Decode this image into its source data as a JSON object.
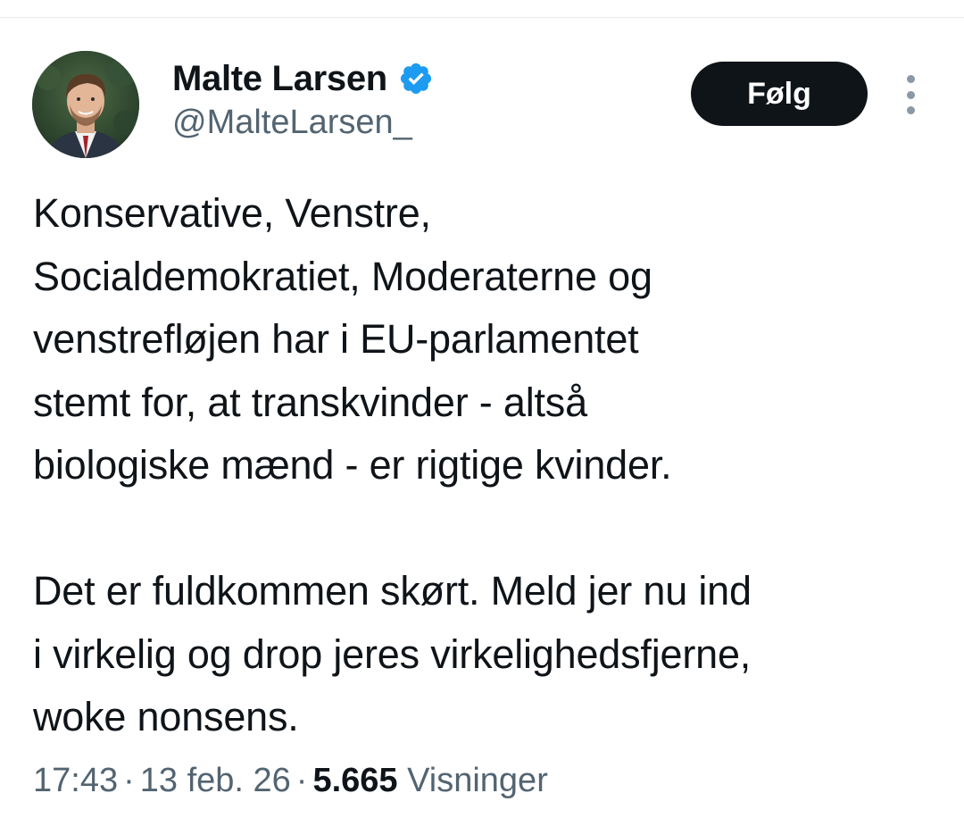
{
  "author": {
    "display_name": "Malte Larsen",
    "handle": "@MalteLarsen_",
    "verified_icon": "verified-badge-icon",
    "avatar_icon": "profile-photo"
  },
  "actions": {
    "follow_label": "Følg",
    "more_icon": "more-vertical-icon"
  },
  "tweet": {
    "paragraph_1": "Konservative, Venstre,\nSocialdemokratiet, Moderaterne og\nvenstrefløjen har i EU-parlamentet\nstemt for, at transkvinder - altså\nbiologiske mænd - er rigtige kvinder.",
    "paragraph_2": "Det er fuldkommen skørt. Meld jer nu ind\ni virkelig og drop jeres virkelighedsfjerne,\nwoke nonsens."
  },
  "meta": {
    "time": "17:43",
    "separator": "·",
    "date": "13 feb. 26",
    "views_count": "5.665",
    "views_label": "Visninger"
  },
  "colors": {
    "verified_blue": "#1d9bf0",
    "follow_bg": "#0f1419",
    "text_primary": "#0f1419",
    "text_secondary": "#536471"
  }
}
